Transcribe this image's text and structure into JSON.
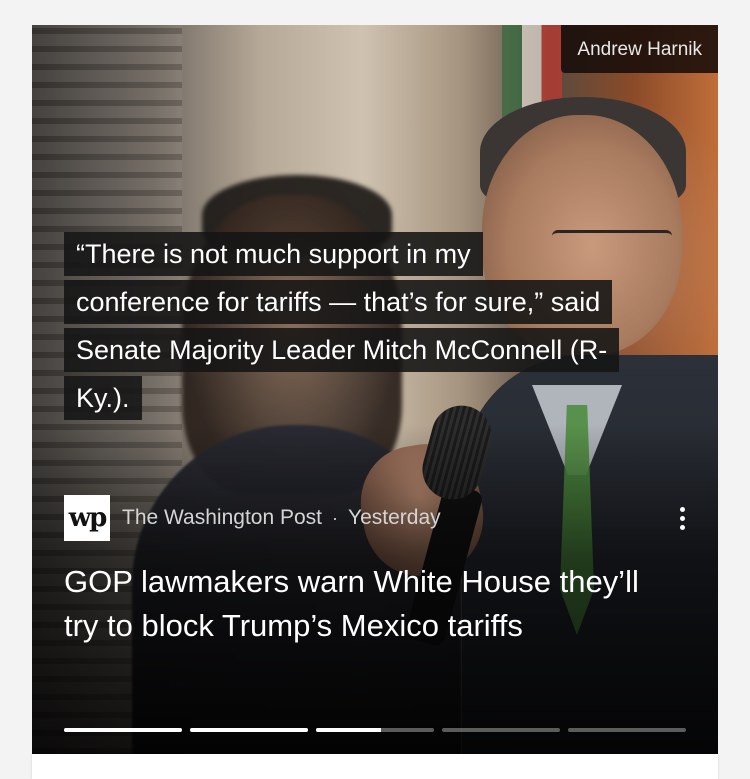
{
  "story": {
    "photo_credit": "Andrew Harnik",
    "quote_lines": [
      "“There is not much support in my",
      "conference for tariffs — that’s for sure,” said",
      "Senate Majority Leader Mitch McConnell (R-",
      "Ky.)."
    ],
    "source": {
      "logo_text": "wp",
      "name": "The Washington Post",
      "separator": "·",
      "time": "Yesterday"
    },
    "headline": "GOP lawmakers warn White House they’ll try to block Trump’s Mexico tariffs",
    "more_icon": "more-vert-icon",
    "progress_segments": [
      1.0,
      1.0,
      0.55,
      0.0,
      0.0
    ]
  }
}
